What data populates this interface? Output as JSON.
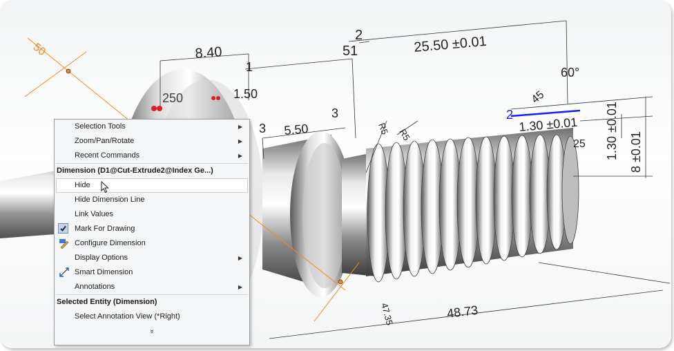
{
  "model": {
    "dims": {
      "d_50": "50",
      "d_840": "8.40",
      "d_1_top": "1",
      "d_150": "1.50",
      "d_2_top": "2",
      "d_51": "51",
      "d_2550": "25.50 ±0.01",
      "d_60deg": "60°",
      "d_45": "45",
      "d_2_blue": "2",
      "d_130a": "1.30 ±0.01",
      "d_130b": "1.30 ±0.01",
      "d_8": "8 ±0.01",
      "d_25": "25",
      "d_3a": "3",
      "d_550": "5.50",
      "d_3b": "3",
      "d_r5a": "R5",
      "d_r5b": "R5",
      "d_4873": "48.73",
      "d_4735": "47.35",
      "d_250": "250"
    },
    "colors": {
      "dimension": "#222222",
      "selected_dimension": "#1a1aff",
      "orange_line": "#f28a1e",
      "red_marker": "#e01e1e"
    }
  },
  "context_menu": {
    "items": [
      {
        "label": "Selection Tools",
        "submenu": true
      },
      {
        "label": "Zoom/Pan/Rotate",
        "submenu": true
      },
      {
        "label": "Recent Commands",
        "submenu": true
      }
    ],
    "section1_header": "Dimension (D1@Cut-Extrude2@Index Ge...)",
    "section1_items": [
      {
        "label": "Hide",
        "state": "hovered"
      },
      {
        "label": "Hide Dimension Line"
      },
      {
        "label": "Link Values"
      },
      {
        "label": "Mark For Drawing",
        "checked": true
      },
      {
        "label": "Configure Dimension",
        "icon": "configure-dimension-icon"
      },
      {
        "label": "Display Options",
        "submenu": true
      },
      {
        "label": "Smart Dimension",
        "icon": "smart-dimension-icon"
      },
      {
        "label": "Annotations",
        "submenu": true
      }
    ],
    "section2_header": "Selected Entity (Dimension)",
    "section2_items": [
      {
        "label": "Select Annotation View (*Right)"
      }
    ],
    "more_glyph": "»"
  }
}
